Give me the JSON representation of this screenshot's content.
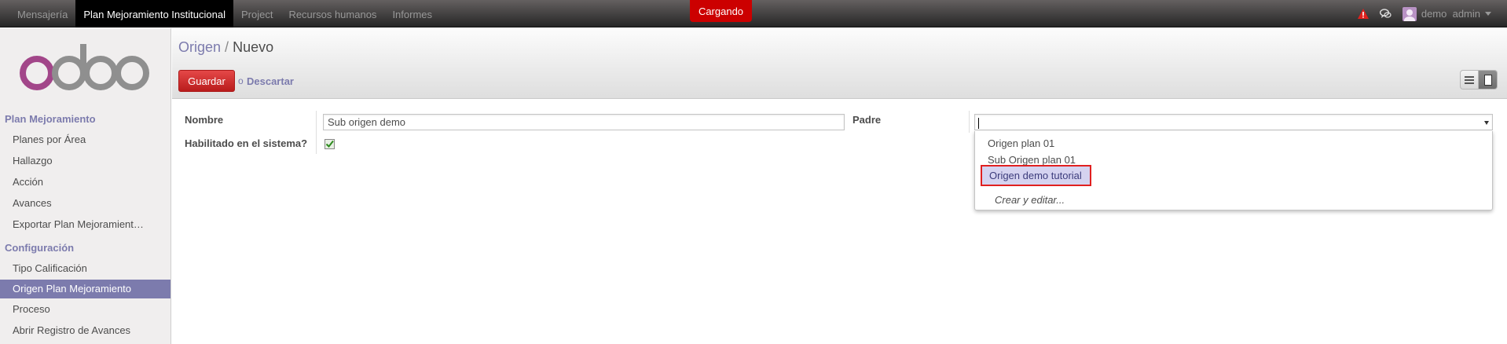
{
  "topbar": {
    "menu": [
      "Mensajería",
      "Plan Mejoramiento Institucional",
      "Project",
      "Recursos humanos",
      "Informes"
    ],
    "loading": "Cargando",
    "user": "demo  admin"
  },
  "sidebar": {
    "logo": "odoo",
    "section1": "Plan Mejoramiento",
    "section1_items": [
      "Planes por Área",
      "Hallazgo",
      "Acción",
      "Avances",
      "Exportar Plan Mejoramient…"
    ],
    "section2": "Configuración",
    "section2_items": [
      "Tipo Calificación",
      "Origen Plan Mejoramiento",
      "Proceso",
      "Abrir Registro de Avances"
    ]
  },
  "header": {
    "breadcrumb_link": "Origen",
    "breadcrumb_sep": "/",
    "breadcrumb_current": "Nuevo",
    "save_label": "Guardar",
    "or_label": "o",
    "discard_label": "Descartar"
  },
  "form": {
    "nombre_label": "Nombre",
    "nombre_value": "Sub origen demo",
    "padre_label": "Padre",
    "padre_value": "",
    "habilitado_label": "Habilitado en el sistema?",
    "habilitado_checked": true
  },
  "dropdown": {
    "options": [
      "Origen plan 01",
      "Sub Origen plan 01",
      "Origen demo tutorial"
    ],
    "create_label": "Crear y editar..."
  },
  "colors": {
    "accent": "#7c7bad",
    "save": "#dc3535",
    "loading": "#cc0000",
    "highlight": "#d5d3f0"
  }
}
